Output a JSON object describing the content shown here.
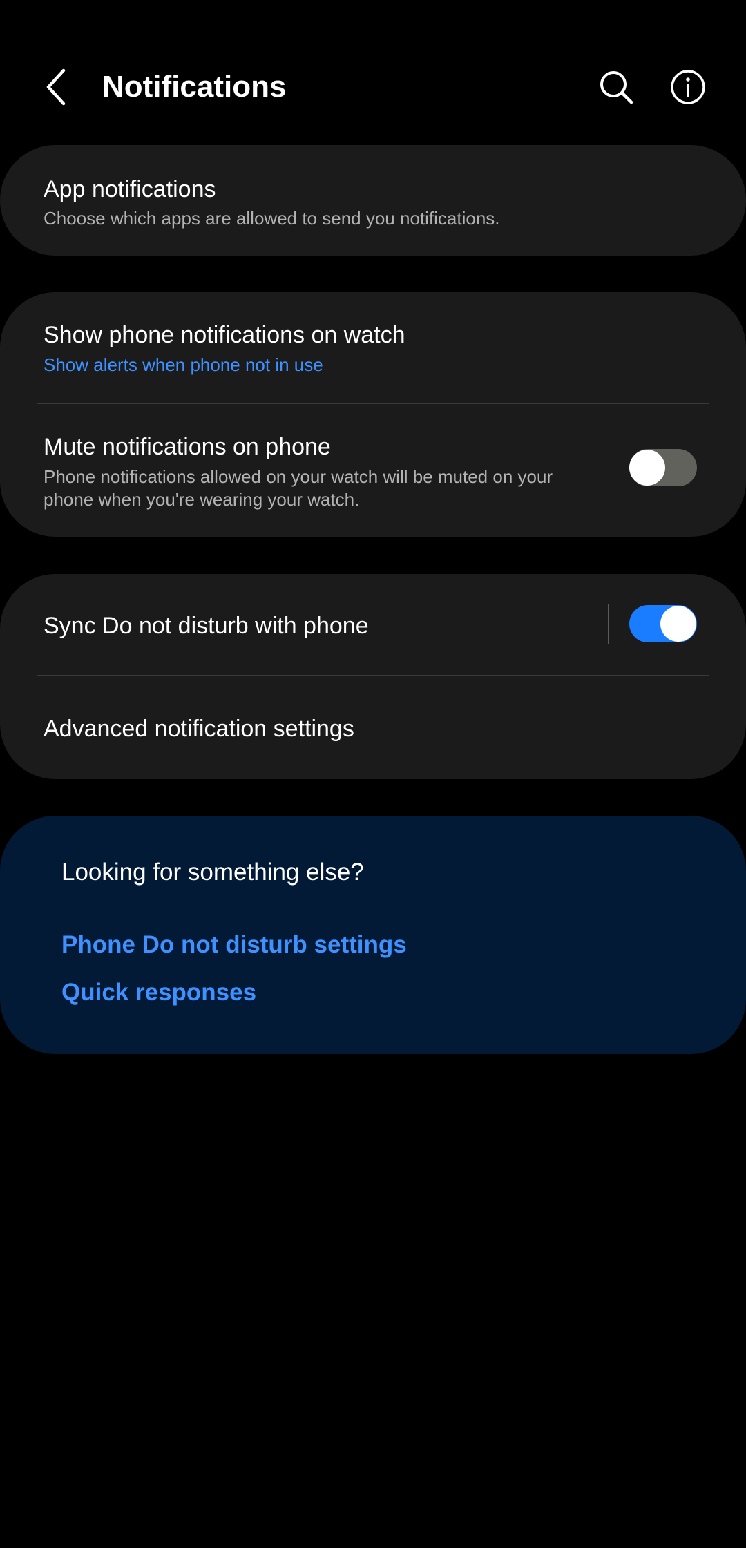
{
  "header": {
    "title": "Notifications",
    "back_icon": "chevron-left-icon",
    "search_icon": "search-icon",
    "info_icon": "info-icon"
  },
  "app_notifications": {
    "title": "App notifications",
    "subtitle": "Choose which apps are allowed to send you notifications."
  },
  "watch_section": {
    "show_on_watch": {
      "title": "Show phone notifications on watch",
      "subtitle": "Show alerts when phone not in use"
    },
    "mute_on_phone": {
      "title": "Mute notifications on phone",
      "subtitle": "Phone notifications allowed on your watch will be muted on your phone when you're wearing your watch.",
      "enabled": false
    }
  },
  "dnd_section": {
    "sync_dnd": {
      "title": "Sync Do not disturb with phone",
      "enabled": true
    },
    "advanced": {
      "title": "Advanced notification settings"
    }
  },
  "looking_else": {
    "title": "Looking for something else?",
    "links": [
      "Phone Do not disturb settings",
      "Quick responses"
    ]
  },
  "colors": {
    "background": "#000000",
    "card": "#1b1b1b",
    "suggestion_card": "#021a35",
    "accent": "#3e91ff",
    "toggle_on": "#1a7dff",
    "toggle_off": "#61625c"
  }
}
